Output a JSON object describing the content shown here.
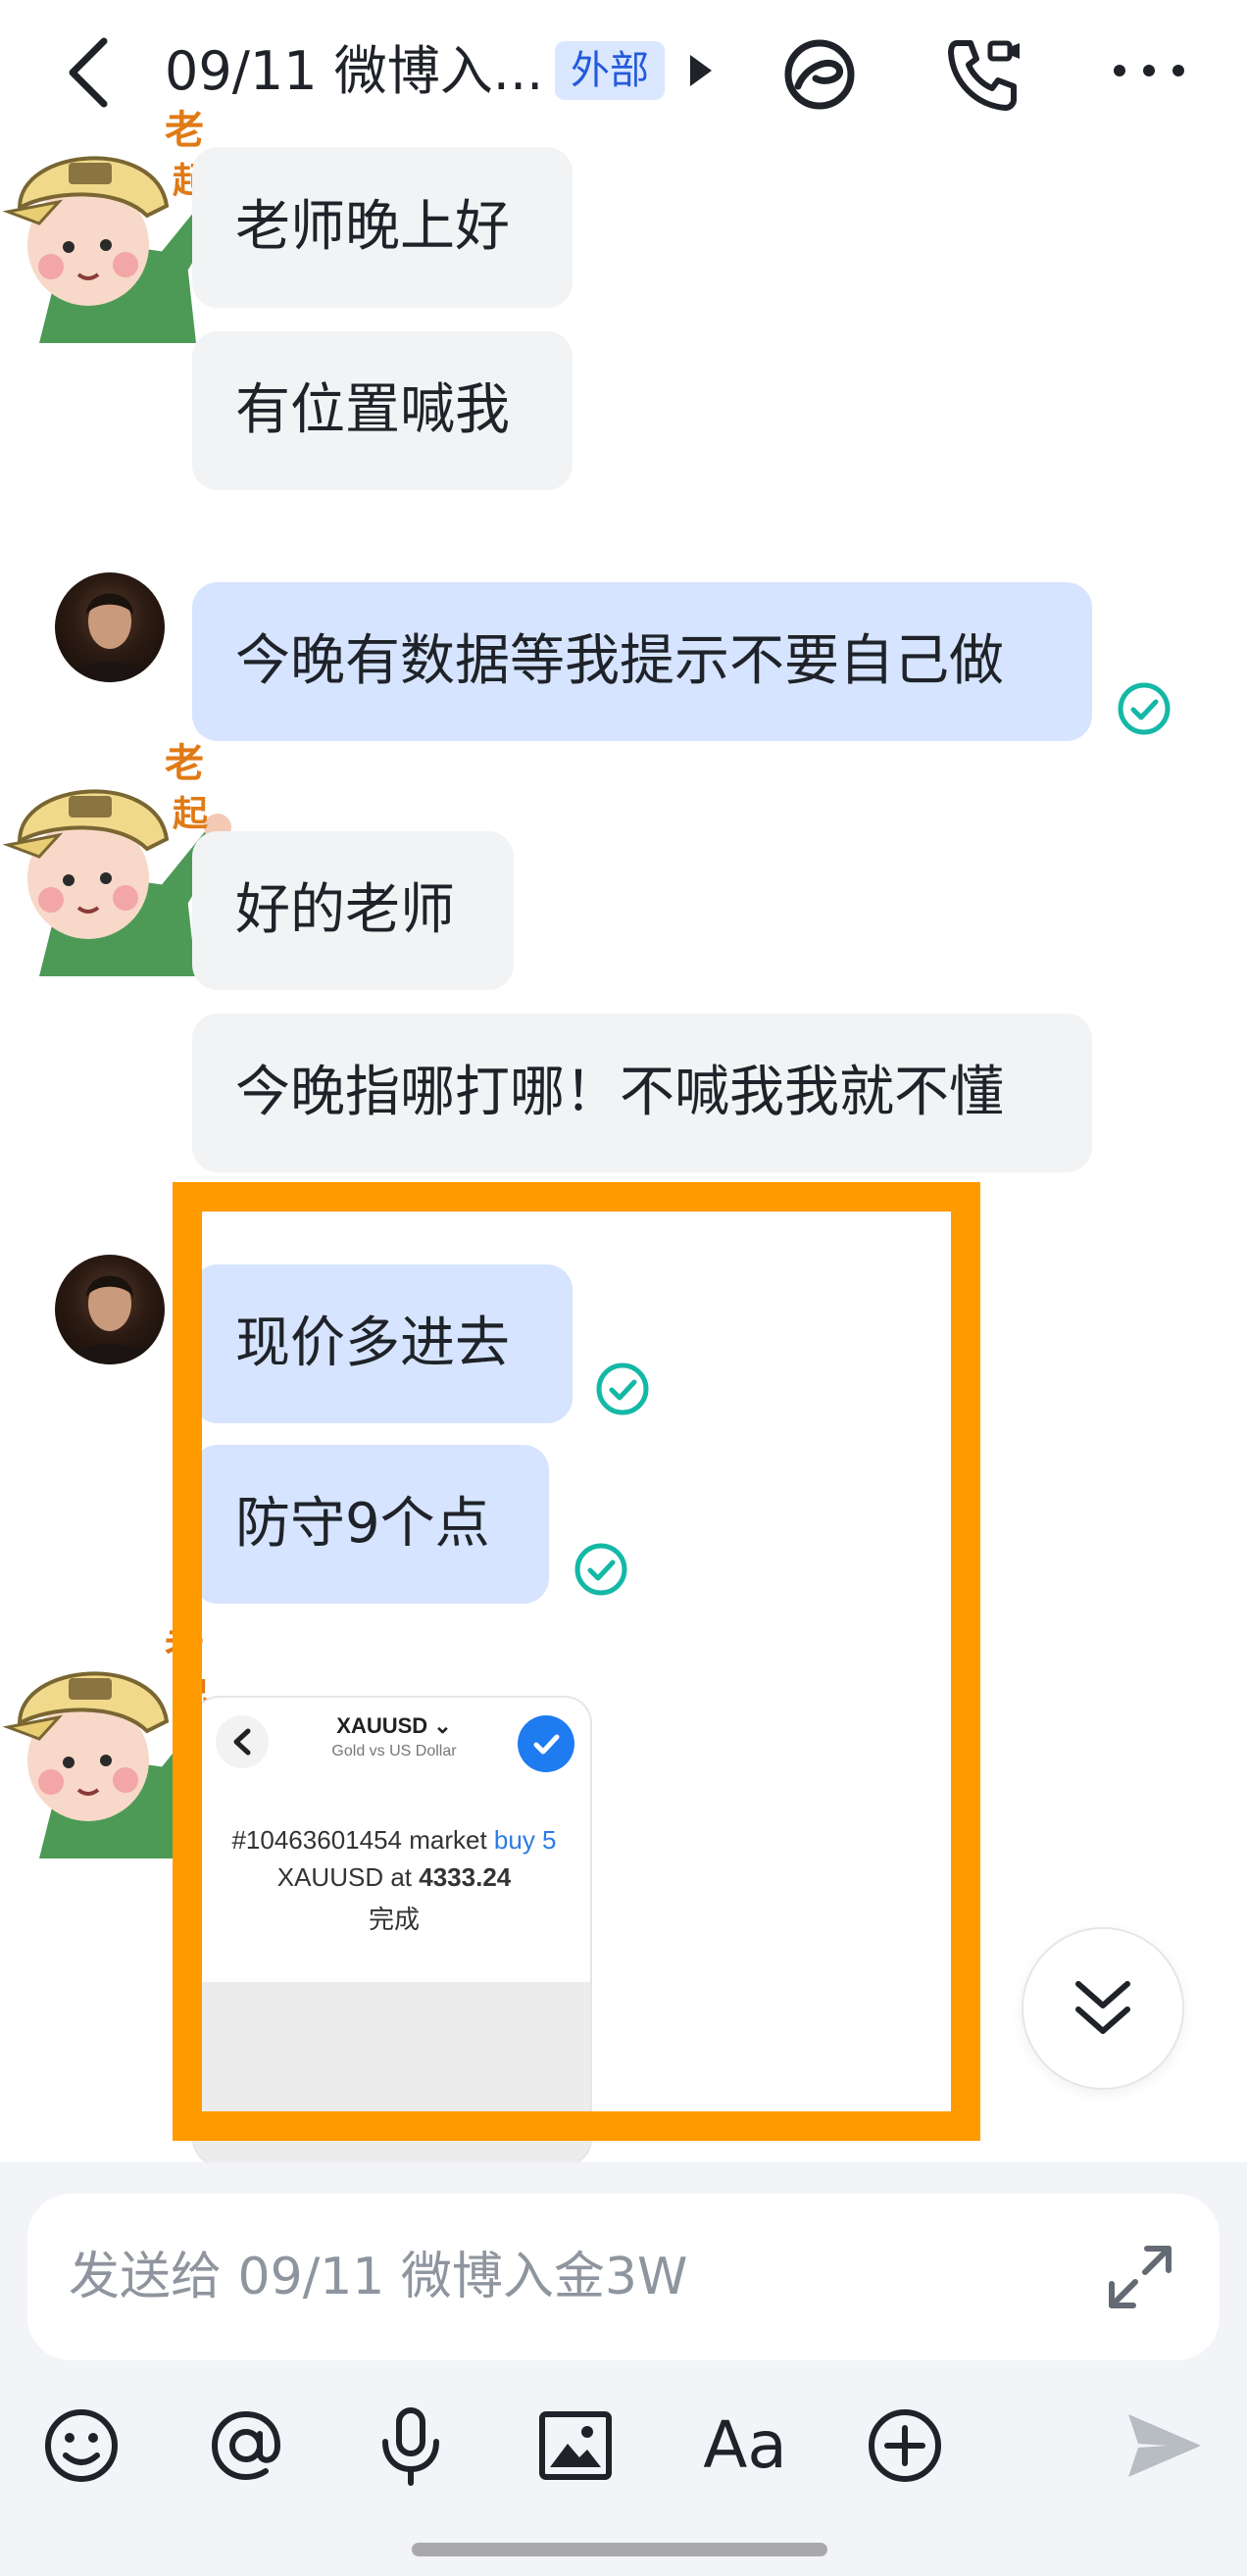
{
  "header": {
    "title": "09/11 微博入...",
    "badge": "外部"
  },
  "messages": {
    "m1": "老师晚上好",
    "m2": "有位置喊我",
    "m3": "今晚有数据等我提示不要自己做",
    "m4": "好的老师",
    "m5": "今晚指哪打哪！不喊我我就不懂",
    "m6": "现价多进去",
    "m7": "防守9个点"
  },
  "sticker_text": "老起",
  "trade_card": {
    "symbol": "XAUUSD",
    "subtitle": "Gold vs US Dollar",
    "line1_prefix": "#10463601454 market ",
    "line1_action": "buy 5",
    "line2_prefix": "XAUUSD at ",
    "line2_price": "4333.24",
    "status": "完成"
  },
  "input": {
    "placeholder": "发送给 09/11 微博入金3W"
  },
  "toolbar": {
    "font_label": "Aa"
  },
  "colors": {
    "accent_blue": "#245bdb",
    "check_teal": "#14b8a6",
    "frame_orange": "#ff9a00",
    "bubble_blue": "#d6e4ff",
    "bubble_gray": "#f2f3f5"
  }
}
